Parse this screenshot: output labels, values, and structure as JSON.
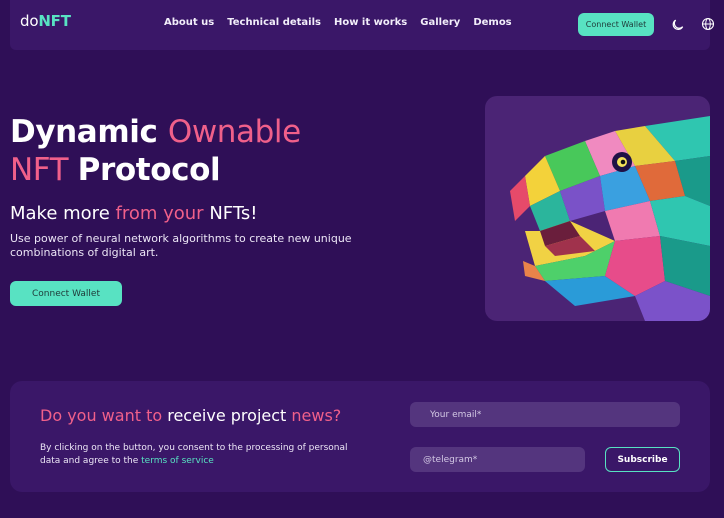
{
  "header": {
    "logo_do": "do",
    "logo_nft": "NFT",
    "nav": [
      "About us",
      "Technical details",
      "How it works",
      "Gallery",
      "Demos"
    ],
    "connect_label": "Connect Wallet",
    "icons": [
      "moon-icon",
      "globe-icon"
    ]
  },
  "hero": {
    "title_dynamic": "Dynamic ",
    "title_ownable": "Ownable",
    "title_nft": "NFT ",
    "title_protocol": "Protocol",
    "sub_1": "Make more ",
    "sub_2": "from your ",
    "sub_3": "NFTs!",
    "description": "Use power of neural network algorithms to create new unique combinations of digital art.",
    "connect_label": "Connect Wallet"
  },
  "newsletter": {
    "title_1": "Do you want to ",
    "title_2": "receive project ",
    "title_3": "news?",
    "consent_text": "By clicking on the button, you consent to the processing of personal data and agree to the ",
    "terms_link": "terms of service",
    "email_placeholder": "Your email*",
    "telegram_placeholder": "@telegram*",
    "subscribe_label": "Subscribe"
  },
  "colors": {
    "background": "#2f0f57",
    "panel": "#3a1768",
    "accent_teal": "#58e2c2",
    "accent_pink": "#f0608a"
  }
}
